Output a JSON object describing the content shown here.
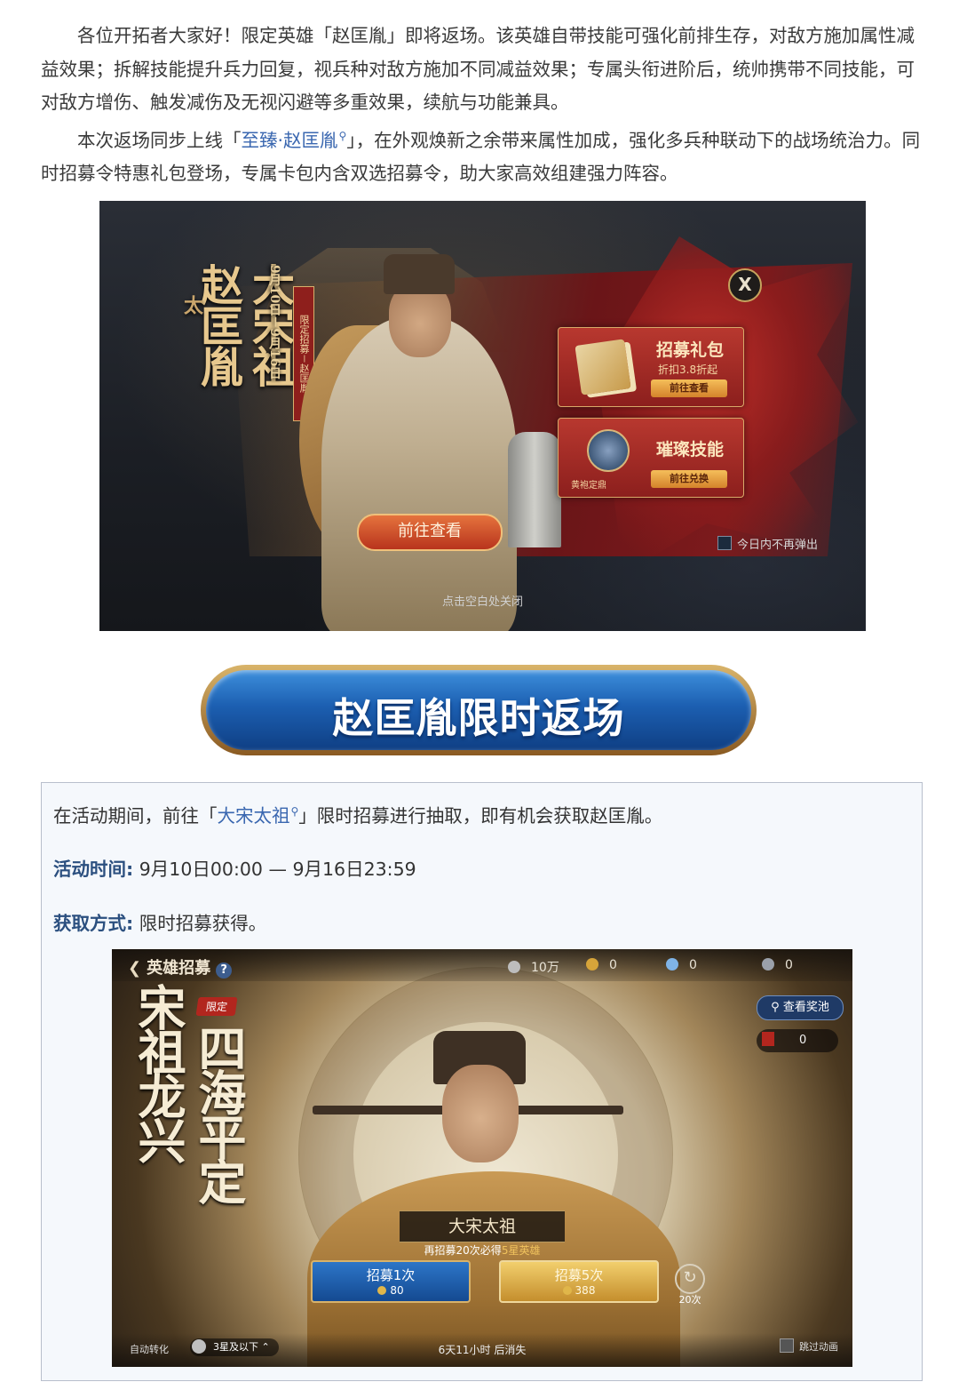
{
  "intro": {
    "p1": "各位开拓者大家好！限定英雄「赵匡胤」即将返场。该英雄自带技能可强化前排生存，对敌方施加属性减益效果；拆解技能提升兵力回复，视兵种对敌方施加不同减益效果；专属头衔进阶后，统帅携带不同技能，可对敌方增伤、触发减伤及无视闪避等多重效果，续航与功能兼具。",
    "p2_before": "本次返场同步上线「",
    "p2_link": "至臻·赵匡胤",
    "p2_after": "」，在外观焕新之余带来属性加成，强化多兵种联动下的战场统治力。同时招募令特惠礼包登场，专属卡包内含双选招募令，助大家高效组建强力阵容。"
  },
  "popup": {
    "title_main": "大宋祖",
    "title_small": "太",
    "title_name": "赵匡胤",
    "date": "9月10日－9月16日",
    "tag": "限定招募－赵匡胤",
    "close": "X",
    "card1": {
      "title": "招募礼包",
      "sub": "折扣3.8折起",
      "button": "前往查看"
    },
    "card2": {
      "title": "璀璨技能",
      "icon_label": "黄袍定鼎",
      "button": "前往兑换"
    },
    "go_button": "前往查看",
    "no_more": "今日内不再弹出",
    "tap_close": "点击空白处关闭"
  },
  "banner": {
    "text": "赵匡胤限时返场"
  },
  "info": {
    "line1_before": "在活动期间，前往「",
    "line1_link": "大宋太祖",
    "line1_after": "」限时招募进行抽取，即有机会获取赵匡胤。",
    "time_label": "活动时间:",
    "time_value": "9月10日00:00 — 9月16日23:59",
    "method_label": "获取方式:",
    "method_value": "限时招募获得。"
  },
  "recruit": {
    "title": "英雄招募",
    "help": "?",
    "resources": [
      {
        "value": "10万",
        "color": "#bdbdbd"
      },
      {
        "value": "0",
        "color": "#d6a43a"
      },
      {
        "value": "0",
        "color": "#7fb3e6"
      },
      {
        "value": "0",
        "color": "#9aa0aa"
      }
    ],
    "limit_tag": "限定",
    "slogan1": "宋祖龙兴",
    "slogan2": "四海平定",
    "pool_button": "查看奖池",
    "ticket_count": "0",
    "hero_name": "大宋太祖",
    "guarantee_before": "再招募20次必得",
    "guarantee_highlight": "5星英雄",
    "btn1_label": "招募1次",
    "btn1_cost": "80",
    "btn5_label": "招募5次",
    "btn5_cost": "388",
    "refresh_label": "20次",
    "auto_convert": "自动转化",
    "star_select": "3星及以下",
    "expire": "6天11小时 后消失",
    "skip": "跳过动画"
  }
}
